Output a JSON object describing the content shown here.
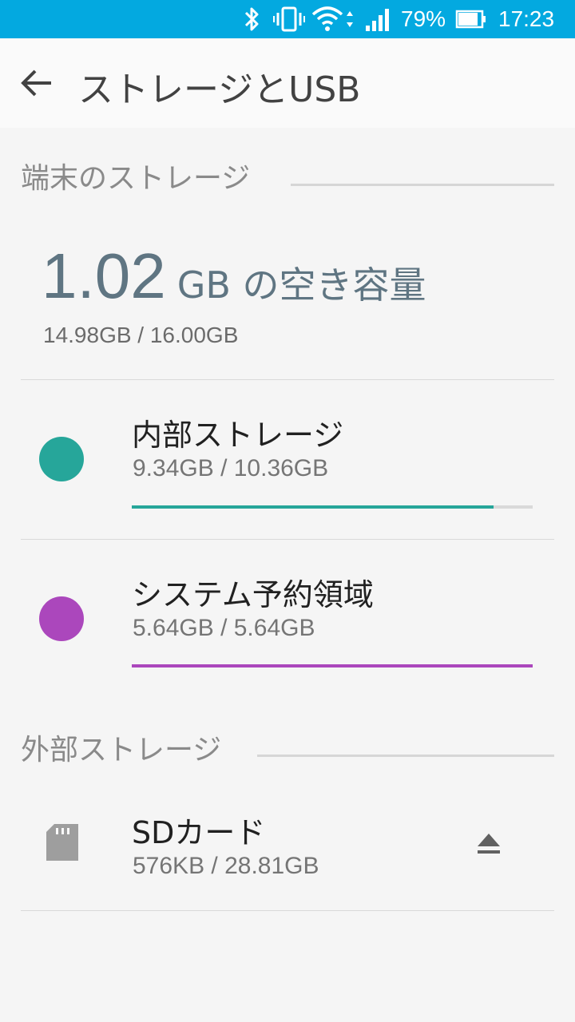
{
  "status_bar": {
    "battery_percent": "79%",
    "time": "17:23",
    "icons": [
      "bluetooth-icon",
      "vibrate-icon",
      "wifi-icon",
      "cell-signal-icon",
      "battery-icon"
    ]
  },
  "app_bar": {
    "back_icon": "arrow-back-icon",
    "title": "ストレージとUSB"
  },
  "device_storage": {
    "header": "端末のストレージ",
    "free_value": "1.02",
    "free_unit": "GB の空き容量",
    "usage_total": "14.98GB / 16.00GB",
    "items": [
      {
        "label": "内部ストレージ",
        "usage": "9.34GB / 10.36GB",
        "color": "#26a69a",
        "fill_fraction": 0.902
      },
      {
        "label": "システム予約領域",
        "usage": "5.64GB / 5.64GB",
        "color": "#ab47bc",
        "fill_fraction": 1.0
      }
    ]
  },
  "external_storage": {
    "header": "外部ストレージ",
    "sd_card": {
      "label": "SDカード",
      "usage": "576KB / 28.81GB",
      "icon": "sd-card-icon",
      "action_icon": "eject-icon"
    }
  },
  "colors": {
    "status_bar": "#03a9e0",
    "internal": "#26a69a",
    "system": "#ab47bc"
  }
}
